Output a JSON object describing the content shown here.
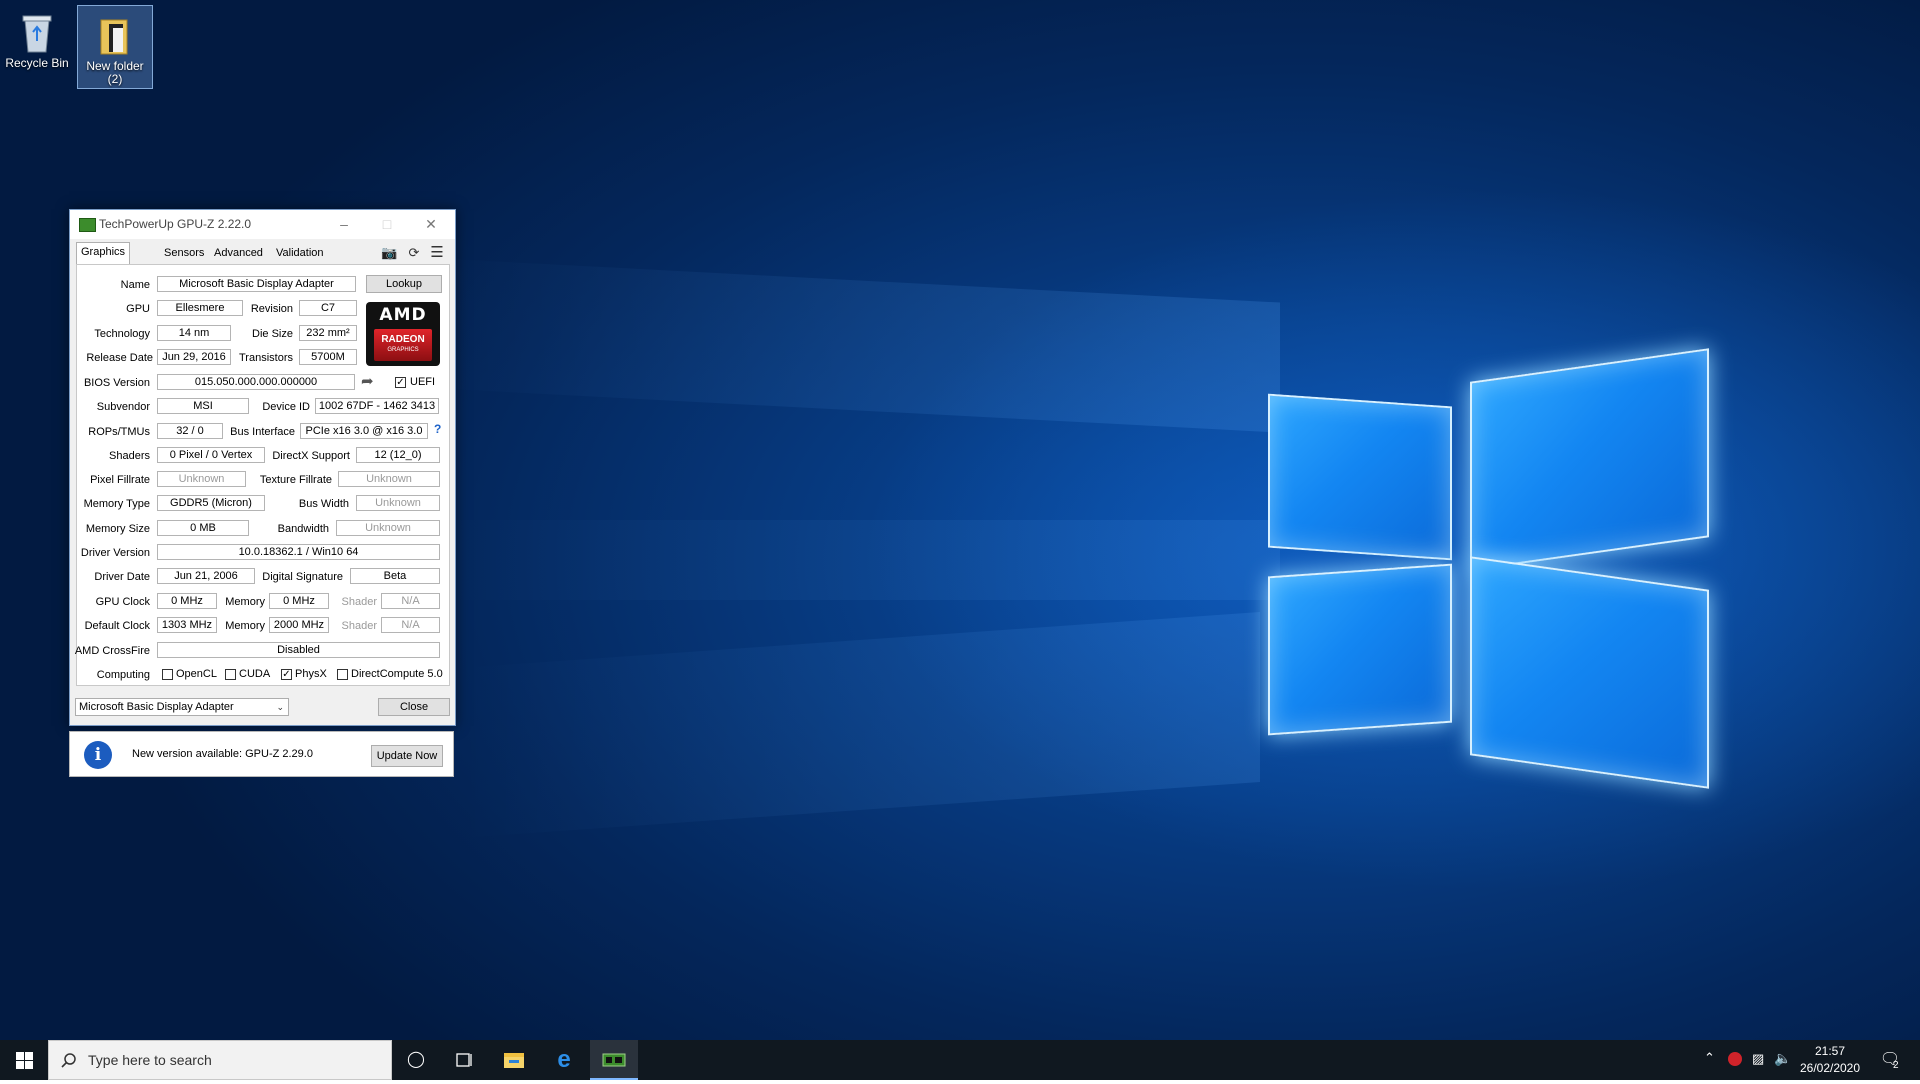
{
  "desktop": {
    "icons": [
      {
        "label": "Recycle Bin"
      },
      {
        "label": "New folder\n(2)"
      }
    ]
  },
  "gpuz": {
    "title": "TechPowerUp GPU-Z 2.22.0",
    "tabs": [
      "Graphics Card",
      "Sensors",
      "Advanced",
      "Validation"
    ],
    "labels": {
      "name": "Name",
      "gpu": "GPU",
      "revision": "Revision",
      "technology": "Technology",
      "die_size": "Die Size",
      "release_date": "Release Date",
      "transistors": "Transistors",
      "bios_version": "BIOS Version",
      "subvendor": "Subvendor",
      "device_id": "Device ID",
      "rops_tmus": "ROPs/TMUs",
      "bus_interface": "Bus Interface",
      "shaders": "Shaders",
      "directx_support": "DirectX Support",
      "pixel_fillrate": "Pixel Fillrate",
      "texture_fillrate": "Texture Fillrate",
      "memory_type": "Memory Type",
      "bus_width": "Bus Width",
      "memory_size": "Memory Size",
      "bandwidth": "Bandwidth",
      "driver_version": "Driver Version",
      "driver_date": "Driver Date",
      "digital_signature": "Digital Signature",
      "gpu_clock": "GPU Clock",
      "memory": "Memory",
      "shader": "Shader",
      "default_clock": "Default Clock",
      "amd_crossfire": "AMD CrossFire",
      "computing": "Computing"
    },
    "values": {
      "name": "Microsoft Basic Display Adapter",
      "gpu": "Ellesmere",
      "revision": "C7",
      "technology": "14 nm",
      "die_size": "232 mm²",
      "release_date": "Jun 29, 2016",
      "transistors": "5700M",
      "bios_version": "015.050.000.000.000000",
      "subvendor": "MSI",
      "device_id": "1002 67DF - 1462 3413",
      "rops_tmus": "32 / 0",
      "bus_interface": "PCIe x16 3.0 @ x16 3.0",
      "shaders": "0 Pixel / 0 Vertex",
      "directx_support": "12 (12_0)",
      "pixel_fillrate": "Unknown",
      "texture_fillrate": "Unknown",
      "memory_type": "GDDR5 (Micron)",
      "bus_width": "Unknown",
      "memory_size": "0 MB",
      "bandwidth": "Unknown",
      "driver_version": "10.0.18362.1 / Win10 64",
      "driver_date": "Jun 21, 2006",
      "digital_signature": "Beta",
      "gpu_clock": "0 MHz",
      "gpu_memory": "0 MHz",
      "gpu_shader": "N/A",
      "default_clock": "1303 MHz",
      "default_memory": "2000 MHz",
      "default_shader": "N/A",
      "amd_crossfire": "Disabled"
    },
    "uefi": {
      "label": "UEFI",
      "checked": true
    },
    "bus_help": "?",
    "lookup_label": "Lookup",
    "close_label": "Close",
    "computing": [
      {
        "label": "OpenCL",
        "checked": false
      },
      {
        "label": "CUDA",
        "checked": false
      },
      {
        "label": "PhysX",
        "checked": true
      },
      {
        "label": "DirectCompute 5.0",
        "checked": false
      }
    ],
    "adapter_select": "Microsoft Basic Display Adapter",
    "logo": {
      "brand": "AMD",
      "line1": "RADEON",
      "line2": "GRAPHICS"
    }
  },
  "notice": {
    "text": "New version available: GPU-Z 2.29.0",
    "button": "Update Now"
  },
  "taskbar": {
    "search_placeholder": "Type here to search",
    "time": "21:57",
    "date": "26/02/2020",
    "notification_count": "2"
  }
}
